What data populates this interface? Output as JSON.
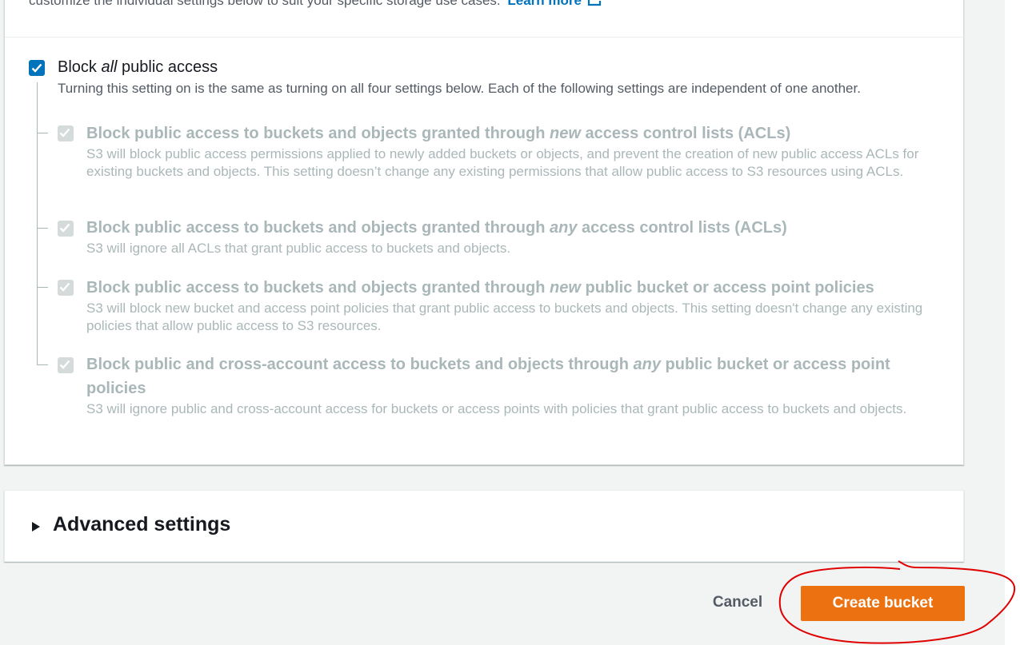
{
  "intro": {
    "text": "customize the individual settings below to suit your specific storage use cases.",
    "learn_more": "Learn more"
  },
  "block_all": {
    "checked": true,
    "label_prefix": "Block ",
    "label_em": "all",
    "label_suffix": " public access",
    "description": "Turning this setting on is the same as turning on all four settings below. Each of the following settings are independent of one another."
  },
  "settings": [
    {
      "checked": true,
      "disabled": true,
      "title_prefix": "Block public access to buckets and objects granted through ",
      "title_em": "new",
      "title_suffix": " access control lists (ACLs)",
      "description": "S3 will block public access permissions applied to newly added buckets or objects, and prevent the creation of new public access ACLs for existing buckets and objects. This setting doesn’t change any existing permissions that allow public access to S3 resources using ACLs."
    },
    {
      "checked": true,
      "disabled": true,
      "title_prefix": "Block public access to buckets and objects granted through ",
      "title_em": "any",
      "title_suffix": " access control lists (ACLs)",
      "description": "S3 will ignore all ACLs that grant public access to buckets and objects."
    },
    {
      "checked": true,
      "disabled": true,
      "title_prefix": "Block public access to buckets and objects granted through ",
      "title_em": "new",
      "title_suffix": " public bucket or access point policies",
      "description": "S3 will block new bucket and access point policies that grant public access to buckets and objects. This setting doesn't change any existing policies that allow public access to S3 resources."
    },
    {
      "checked": true,
      "disabled": true,
      "title_prefix": "Block public and cross-account access to buckets and objects through ",
      "title_em": "any",
      "title_suffix": " public bucket or access point policies",
      "description": "S3 will ignore public and cross-account access for buckets or access points with policies that grant public access to buckets and objects."
    }
  ],
  "advanced": {
    "label": "Advanced settings",
    "expanded": false
  },
  "actions": {
    "cancel": "Cancel",
    "create": "Create bucket"
  },
  "colors": {
    "primary_button": "#ec7211",
    "link": "#0073bb",
    "checkbox_checked": "#0073bb",
    "disabled_text": "#aab7b8",
    "annotation": "#e00000"
  }
}
